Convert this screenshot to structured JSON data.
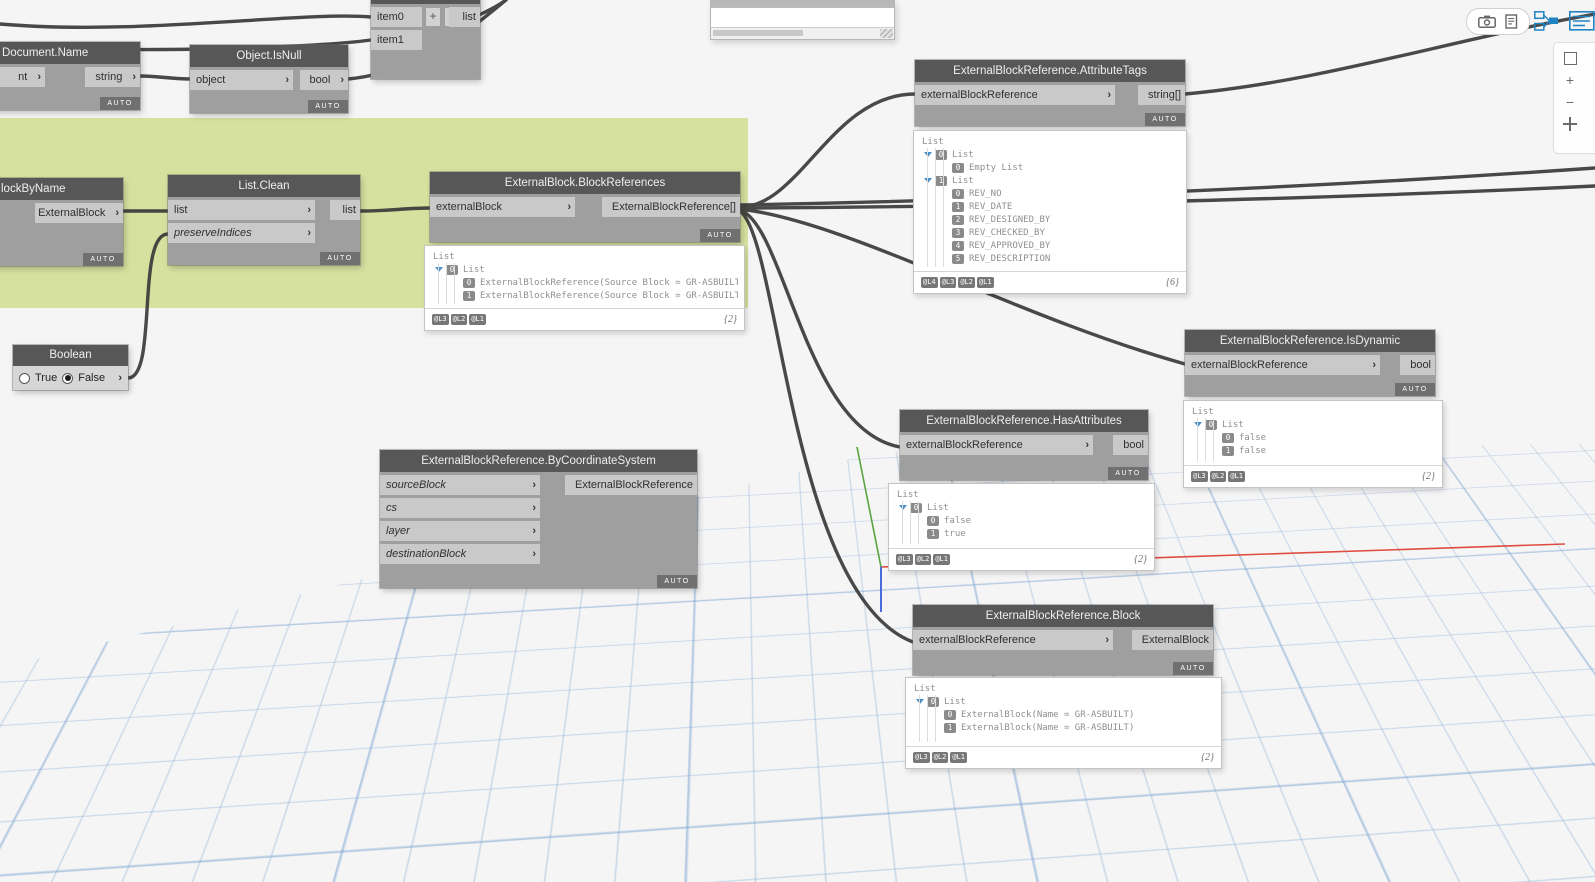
{
  "colors": {
    "group": "#d7e19f",
    "wire": "#3b3b3b",
    "axis_x": "#e04b3f",
    "axis_y": "#59a341",
    "axis_z": "#4a6bdc",
    "grid": "#7da5cf",
    "node_header": "#575757",
    "port": "#c9c9c9"
  },
  "nodes": {
    "document_name": {
      "title": "Document.Name",
      "input": "nt",
      "output": "string",
      "auto": "AUTO"
    },
    "object_is_null": {
      "title": "Object.IsNull",
      "input": "object",
      "output": "bool",
      "auto": "AUTO"
    },
    "list_create": {
      "inputs": [
        "item0",
        "item1"
      ],
      "output": "list",
      "add": "+",
      "remove": "-"
    },
    "external_block_by_name": {
      "title": "lockByName",
      "output": "ExternalBlock",
      "auto": "AUTO"
    },
    "list_clean": {
      "title": "List.Clean",
      "inputs": [
        "list",
        "preserveIndices"
      ],
      "output": "list",
      "auto": "AUTO"
    },
    "block_references": {
      "title": "ExternalBlock.BlockReferences",
      "input": "externalBlock",
      "output": "ExternalBlockReference[]",
      "auto": "AUTO"
    },
    "boolean": {
      "title": "Boolean",
      "options": [
        "True",
        "False"
      ],
      "selected": "False",
      "output": "›"
    },
    "attribute_tags": {
      "title": "ExternalBlockReference.AttributeTags",
      "input": "externalBlockReference",
      "output": "string[]",
      "auto": "AUTO"
    },
    "is_dynamic": {
      "title": "ExternalBlockReference.IsDynamic",
      "input": "externalBlockReference",
      "output": "bool",
      "auto": "AUTO"
    },
    "has_attributes": {
      "title": "ExternalBlockReference.HasAttributes",
      "input": "externalBlockReference",
      "output": "bool",
      "auto": "AUTO"
    },
    "by_coordinate_system": {
      "title": "ExternalBlockReference.ByCoordinateSystem",
      "inputs": [
        "sourceBlock",
        "cs",
        "layer",
        "destinationBlock"
      ],
      "output": "ExternalBlockReference",
      "auto": "AUTO"
    },
    "block": {
      "title": "ExternalBlockReference.Block",
      "input": "externalBlockReference",
      "output": "ExternalBlock",
      "auto": "AUTO"
    }
  },
  "previews": {
    "block_references": {
      "rows": [
        {
          "lvl": 0,
          "text": "List"
        },
        {
          "lvl": 1,
          "arrow": true,
          "idx": "0",
          "text": "List"
        },
        {
          "lvl": 2,
          "idx": "0",
          "text": "ExternalBlockReference(Source Block = GR-ASBUILT)"
        },
        {
          "lvl": 2,
          "idx": "1",
          "text": "ExternalBlockReference(Source Block = GR-ASBUILT)"
        }
      ],
      "levels": [
        "@L3",
        "@L2",
        "@L1"
      ],
      "count": "{2}"
    },
    "attribute_tags": {
      "rows": [
        {
          "lvl": 0,
          "text": "List"
        },
        {
          "lvl": 1,
          "arrow": true,
          "idx": "0",
          "text": "List"
        },
        {
          "lvl": 2,
          "idx": "0",
          "text": "Empty List"
        },
        {
          "lvl": 1,
          "arrow": true,
          "idx": "1",
          "text": "List"
        },
        {
          "lvl": 2,
          "idx": "0",
          "text": "REV_NO"
        },
        {
          "lvl": 2,
          "idx": "1",
          "text": "REV_DATE"
        },
        {
          "lvl": 2,
          "idx": "2",
          "text": "REV_DESIGNED_BY"
        },
        {
          "lvl": 2,
          "idx": "3",
          "text": "REV_CHECKED_BY"
        },
        {
          "lvl": 2,
          "idx": "4",
          "text": "REV_APPROVED_BY"
        },
        {
          "lvl": 2,
          "idx": "5",
          "text": "REV_DESCRIPTION"
        }
      ],
      "levels": [
        "@L4",
        "@L3",
        "@L2",
        "@L1"
      ],
      "count": "{6}"
    },
    "is_dynamic": {
      "rows": [
        {
          "lvl": 0,
          "text": "List"
        },
        {
          "lvl": 1,
          "arrow": true,
          "idx": "0",
          "text": "List"
        },
        {
          "lvl": 2,
          "idx": "0",
          "text": "false"
        },
        {
          "lvl": 2,
          "idx": "1",
          "text": "false"
        }
      ],
      "levels": [
        "@L3",
        "@L2",
        "@L1"
      ],
      "count": "{2}"
    },
    "has_attributes": {
      "rows": [
        {
          "lvl": 0,
          "text": "List"
        },
        {
          "lvl": 1,
          "arrow": true,
          "idx": "0",
          "text": "List"
        },
        {
          "lvl": 2,
          "idx": "0",
          "text": "false"
        },
        {
          "lvl": 2,
          "idx": "1",
          "text": "true"
        }
      ],
      "levels": [
        "@L3",
        "@L2",
        "@L1"
      ],
      "count": "{2}"
    },
    "block": {
      "rows": [
        {
          "lvl": 0,
          "text": "List"
        },
        {
          "lvl": 1,
          "arrow": true,
          "idx": "0",
          "text": "List"
        },
        {
          "lvl": 2,
          "idx": "0",
          "text": "ExternalBlock(Name = GR-ASBUILT)"
        },
        {
          "lvl": 2,
          "idx": "1",
          "text": "ExternalBlock(Name = GR-ASBUILT)"
        }
      ],
      "levels": [
        "@L3",
        "@L2",
        "@L1"
      ],
      "count": "{2}"
    }
  },
  "side_controls": {
    "zoom_in": "+",
    "zoom_out": "−"
  }
}
